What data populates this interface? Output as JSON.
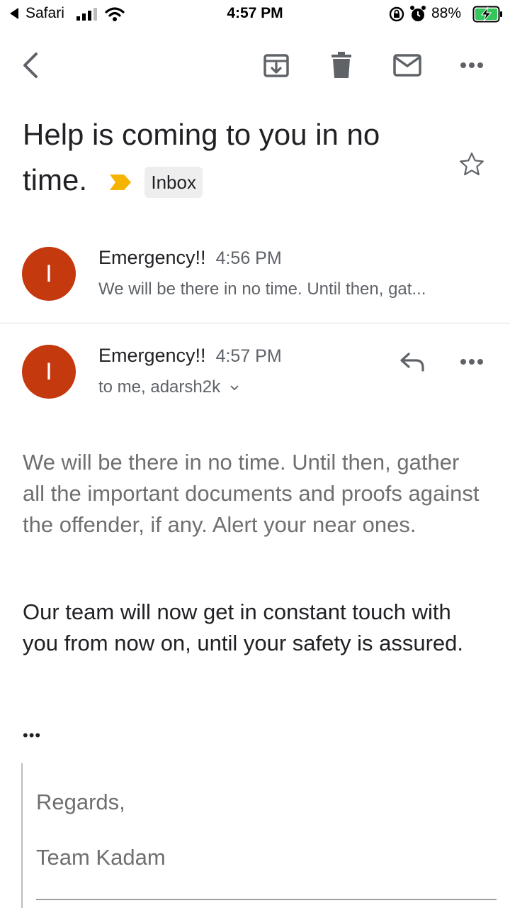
{
  "status_bar": {
    "back_app": "Safari",
    "time": "4:57 PM",
    "battery": "88%"
  },
  "toolbar": {
    "back": "back-arrow-icon",
    "archive": "archive-icon",
    "delete": "trash-icon",
    "mark_unread": "mail-icon",
    "more": "more-horizontal-icon"
  },
  "subject": {
    "text": "Help is coming to you in no time.",
    "label": "Inbox",
    "important_color": "#f4b400"
  },
  "messages": [
    {
      "avatar_letter": "I",
      "sender": "Emergency!!",
      "time": "4:56 PM",
      "snippet": "We will be there in no time. Until then, gat..."
    },
    {
      "avatar_letter": "I",
      "sender": "Emergency!!",
      "time": "4:57 PM",
      "recipients": "to me, adarsh2k"
    }
  ],
  "body": {
    "paragraph_1": "We will be there in no time. Until then, gather all the important documents and proofs against the offender, if any. Alert your near ones.",
    "paragraph_2": "Our team will now get in constant touch with you from now on, until your safety is assured.",
    "ellipsis": "•••",
    "signature_1": "Regards,",
    "signature_2": "Team Kadam"
  },
  "colors": {
    "avatar": "#c5390f",
    "accent_grey": "#5f6368"
  }
}
